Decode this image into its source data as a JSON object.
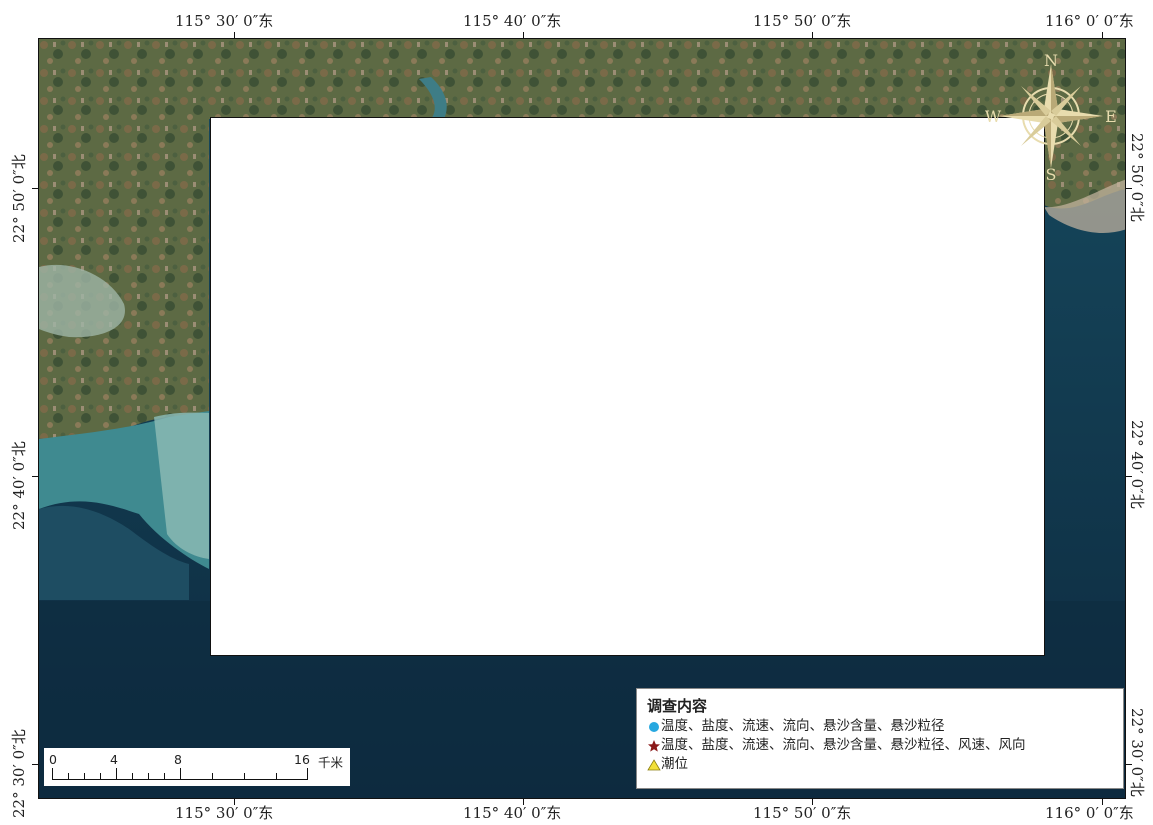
{
  "map": {
    "top_lon_labels": [
      "115° 30′ 0″东",
      "115° 40′ 0″东",
      "115° 50′ 0″东",
      "116° 0′ 0″东"
    ],
    "bottom_lon_labels": [
      "115° 30′ 0″东",
      "115° 40′ 0″东",
      "115° 50′ 0″东",
      "116° 0′ 0″东"
    ],
    "left_lat_labels": [
      "22° 50′ 0″北",
      "22° 40′ 0″北",
      "22° 30′ 0″北"
    ],
    "right_lat_labels": [
      "22° 50′ 0″北",
      "22° 40′ 0″北",
      "22° 30′ 0″北"
    ],
    "compass": {
      "n": "N",
      "e": "E",
      "s": "S",
      "w": "W",
      "color": "#e8dcae"
    },
    "colors": {
      "sea_deep": "#0f2e45",
      "sea_shallow": "#4f8c8e",
      "land": "#5e6b45"
    }
  },
  "legend": {
    "title": "调查内容",
    "items": [
      {
        "symbol": "dot-icon",
        "color": "#27a8e0",
        "label": "温度、盐度、流速、流向、悬沙含量、悬沙粒径"
      },
      {
        "symbol": "star-icon",
        "color": "#8b1a1a",
        "label": "温度、盐度、流速、流向、悬沙含量、悬沙粒径、风速、风向"
      },
      {
        "symbol": "triangle-icon",
        "color": "#f2e03a",
        "label": "潮位"
      }
    ]
  },
  "scalebar": {
    "labels": [
      "0",
      "4",
      "8",
      "16"
    ],
    "unit": "千米"
  }
}
